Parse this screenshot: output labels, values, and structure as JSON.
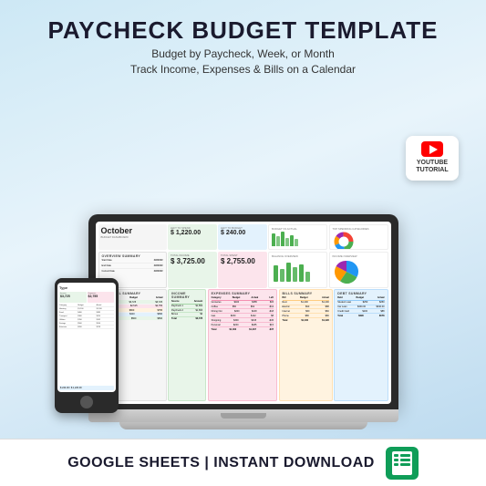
{
  "page": {
    "title": "PAYCHECK BUDGET TEMPLATE",
    "subtitle1": "Budget by Paycheck, Week, or Month",
    "subtitle2": "Track Income, Expenses & Bills on a Calendar"
  },
  "footer": {
    "text": "GOOGLE SHEETS | INSTANT DOWNLOAD"
  },
  "youtube": {
    "label": "YOUTUBE\nTUTORIAL"
  },
  "spreadsheet": {
    "month": "October",
    "subtitle": "BUDGET DASHBOARD",
    "left_to_spend_label": "LEFT TO SPEND",
    "left_to_spend_value": "$ 1,220.00",
    "left_to_budget_label": "LEFT TO BUDGET",
    "left_to_budget_value": "$ 240.00",
    "total_income_label": "TOTAL INCOME",
    "total_income_value": "$ 3,725.00",
    "total_spent_label": "TOTAL SPENT",
    "total_spent_value": "$ 2,755.00",
    "overview_summary_label": "OVERVIEW SUMMARY",
    "financial_summary_label": "FINANCIAL SUMMARY",
    "balance_overview_label": "BALANCE OVERVIEW",
    "income_overview_label": "INCOME OVERVIEW",
    "budget_vs_actual_label": "BUDGET VS ACTUAL",
    "top_spending_label": "TOP SPENDING CATEGORIES",
    "spending_overview_label": "SPENDING OVERVIEW",
    "income_summary_label": "INCOME SUMMARY",
    "expenses_summary_label": "EXPENSES SUMMARY",
    "bills_summary_label": "BILLS SUMMARY",
    "debt_summary_label": "DEBT SUMMARY"
  },
  "colors": {
    "green": "#e8f5e9",
    "blue": "#e3f2fd",
    "orange": "#fff3e0",
    "pink": "#fce4ec",
    "purple": "#f3e5f5",
    "teal": "#e0f7fa",
    "yellow": "#fffde7",
    "red": "#ffebee",
    "bar1": "#4CAF50",
    "bar2": "#2196F3",
    "bar3": "#FF9800",
    "bar4": "#E91E63",
    "pie1": "#4CAF50",
    "pie2": "#2196F3",
    "pie3": "#FF9800",
    "pie4": "#9C27B0",
    "pie5": "#F44336"
  }
}
